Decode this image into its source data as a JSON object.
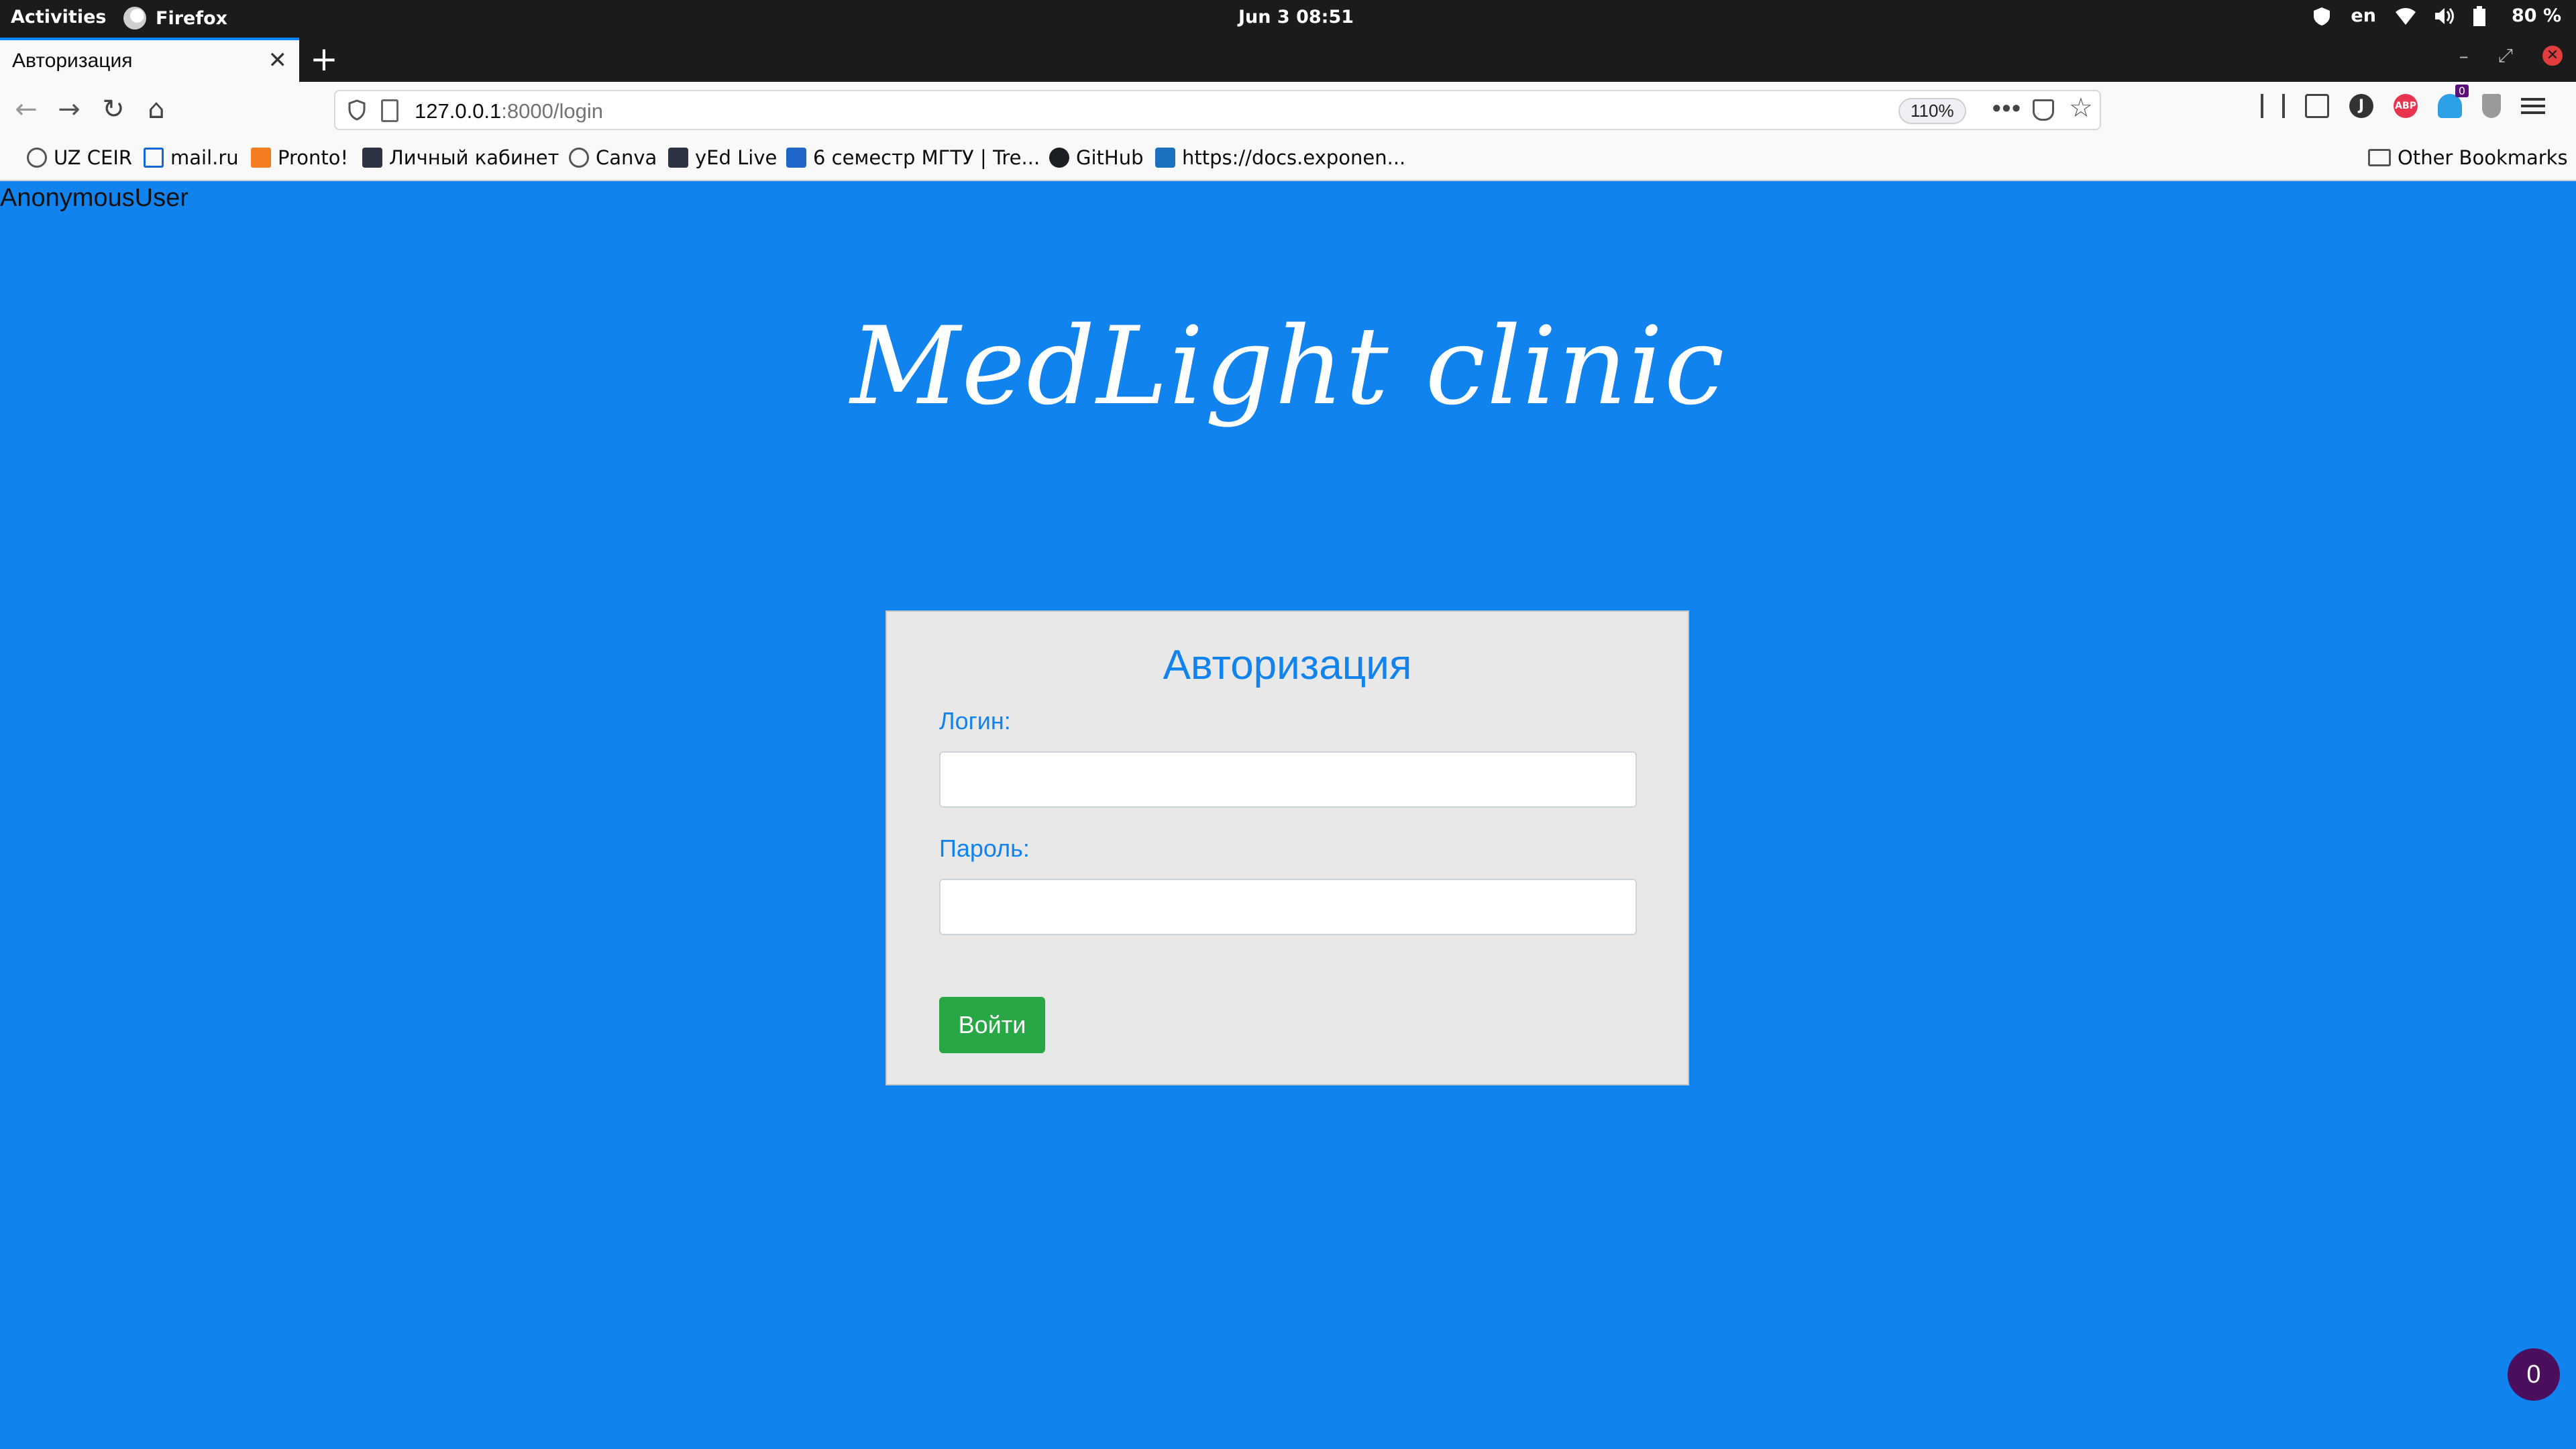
{
  "gnome": {
    "activities": "Activities",
    "app_name": "Firefox",
    "clock": "Jun 3  08:51",
    "lang": "en",
    "battery": "80 %"
  },
  "tab": {
    "title": "Авторизация",
    "close": "✕",
    "new_tab": "+"
  },
  "window": {
    "minimize": "–",
    "restore": "⤢",
    "close": "✕"
  },
  "nav": {
    "back": "←",
    "forward": "→",
    "reload": "↻",
    "home": "⌂",
    "url_host": "127.0.0.1",
    "url_path": ":8000/login",
    "zoom": "110%",
    "more": "•••",
    "star": "☆",
    "ghostery_badge": "0",
    "j_icon": "J",
    "abp_icon": "ABP"
  },
  "bookmarks": [
    {
      "label": "UZ CEIR",
      "icon": "globe-icon"
    },
    {
      "label": "mail.ru",
      "icon": "mail-icon"
    },
    {
      "label": "Pronto!",
      "icon": "pronto-icon"
    },
    {
      "label": "Личный кабинет",
      "icon": "cabinet-icon"
    },
    {
      "label": "Canva",
      "icon": "globe-icon"
    },
    {
      "label": "yEd Live",
      "icon": "yed-icon"
    },
    {
      "label": "6 семестр МГТУ | Tre...",
      "icon": "trello-icon"
    },
    {
      "label": "GitHub",
      "icon": "github-icon"
    },
    {
      "label": "https://docs.exponen...",
      "icon": "docs-icon"
    }
  ],
  "other_bookmarks": "Other Bookmarks",
  "page": {
    "user": "AnonymousUser",
    "brand": "MedLight clinic",
    "card_title": "Авторизация",
    "login_label": "Логин:",
    "login_value": "",
    "password_label": "Пароль:",
    "password_value": "",
    "submit": "Войти",
    "badge_count": "0"
  },
  "colors": {
    "page_bg": "#1083ee",
    "card_bg": "#e8e8e8",
    "accent_text": "#1083ee",
    "submit_bg": "#28a745",
    "badge_bg": "#4a0e5c"
  }
}
